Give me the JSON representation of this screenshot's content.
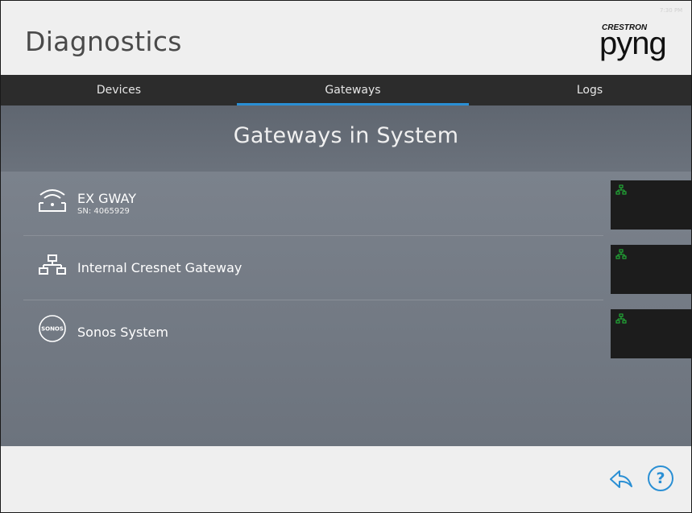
{
  "header": {
    "title": "Diagnostics",
    "clock": "7:30 PM",
    "logo": {
      "small": "CRESTRON",
      "big": "pyng"
    }
  },
  "tabs": [
    {
      "label": "Devices",
      "active": false
    },
    {
      "label": "Gateways",
      "active": true
    },
    {
      "label": "Logs",
      "active": false
    }
  ],
  "section": {
    "title": "Gateways in System"
  },
  "gateways": [
    {
      "name": "EX GWAY",
      "sn": "SN: 4065929",
      "icon": "router-icon",
      "status_icon": "network-icon"
    },
    {
      "name": "Internal Cresnet Gateway",
      "sn": "",
      "icon": "network-icon",
      "status_icon": "network-icon"
    },
    {
      "name": "Sonos System",
      "sn": "",
      "icon": "sonos-icon",
      "status_icon": "network-icon"
    }
  ],
  "footer": {
    "back_icon": "back-arrow-icon",
    "help_label": "?"
  },
  "colors": {
    "accent": "#2a8fd4",
    "tab_bar": "#2c2c2c",
    "panel": "#737a85",
    "status_online": "#22c13a"
  }
}
